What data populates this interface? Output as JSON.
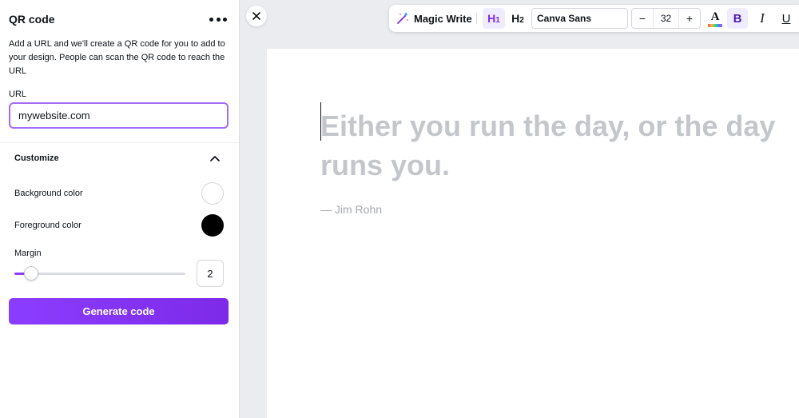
{
  "panel": {
    "title": "QR code",
    "more_icon": "more-horizontal-icon",
    "description": "Add a URL and we'll create a QR code for you to add to your design. People can scan the QR code to reach the URL",
    "url_label": "URL",
    "url_value": "mywebsite.com",
    "customize": {
      "label": "Customize",
      "toggle_icon": "chevron-up-icon",
      "background_color_label": "Background color",
      "background_color": "#ffffff",
      "foreground_color_label": "Foreground color",
      "foreground_color": "#000000",
      "margin_label": "Margin",
      "margin_value": "2",
      "margin_slider_fraction": 0.1
    },
    "generate_button": "Generate code"
  },
  "close_icon": "close-icon",
  "toolbar": {
    "magic_write_label": "Magic Write",
    "magic_write_icon": "magic-wand-icon",
    "h1_label": "H",
    "h1_sub": "1",
    "h2_label": "H",
    "h2_sub": "2",
    "font_name": "Canva Sans",
    "minus_label": "−",
    "font_size": "32",
    "plus_label": "+",
    "text_color_label": "A",
    "bold_label": "B",
    "italic_label": "I",
    "underline_label": "U"
  },
  "canvas": {
    "quote": "Either you run the day, or the day runs you.",
    "author": "— Jim Rohn"
  },
  "colors": {
    "accent": "#8b3dff",
    "accent_border": "#a56cf5",
    "placeholder_text": "#c3c6cb",
    "author_text": "#a6a9ae",
    "button_gradient_end": "#7d2ae8"
  }
}
